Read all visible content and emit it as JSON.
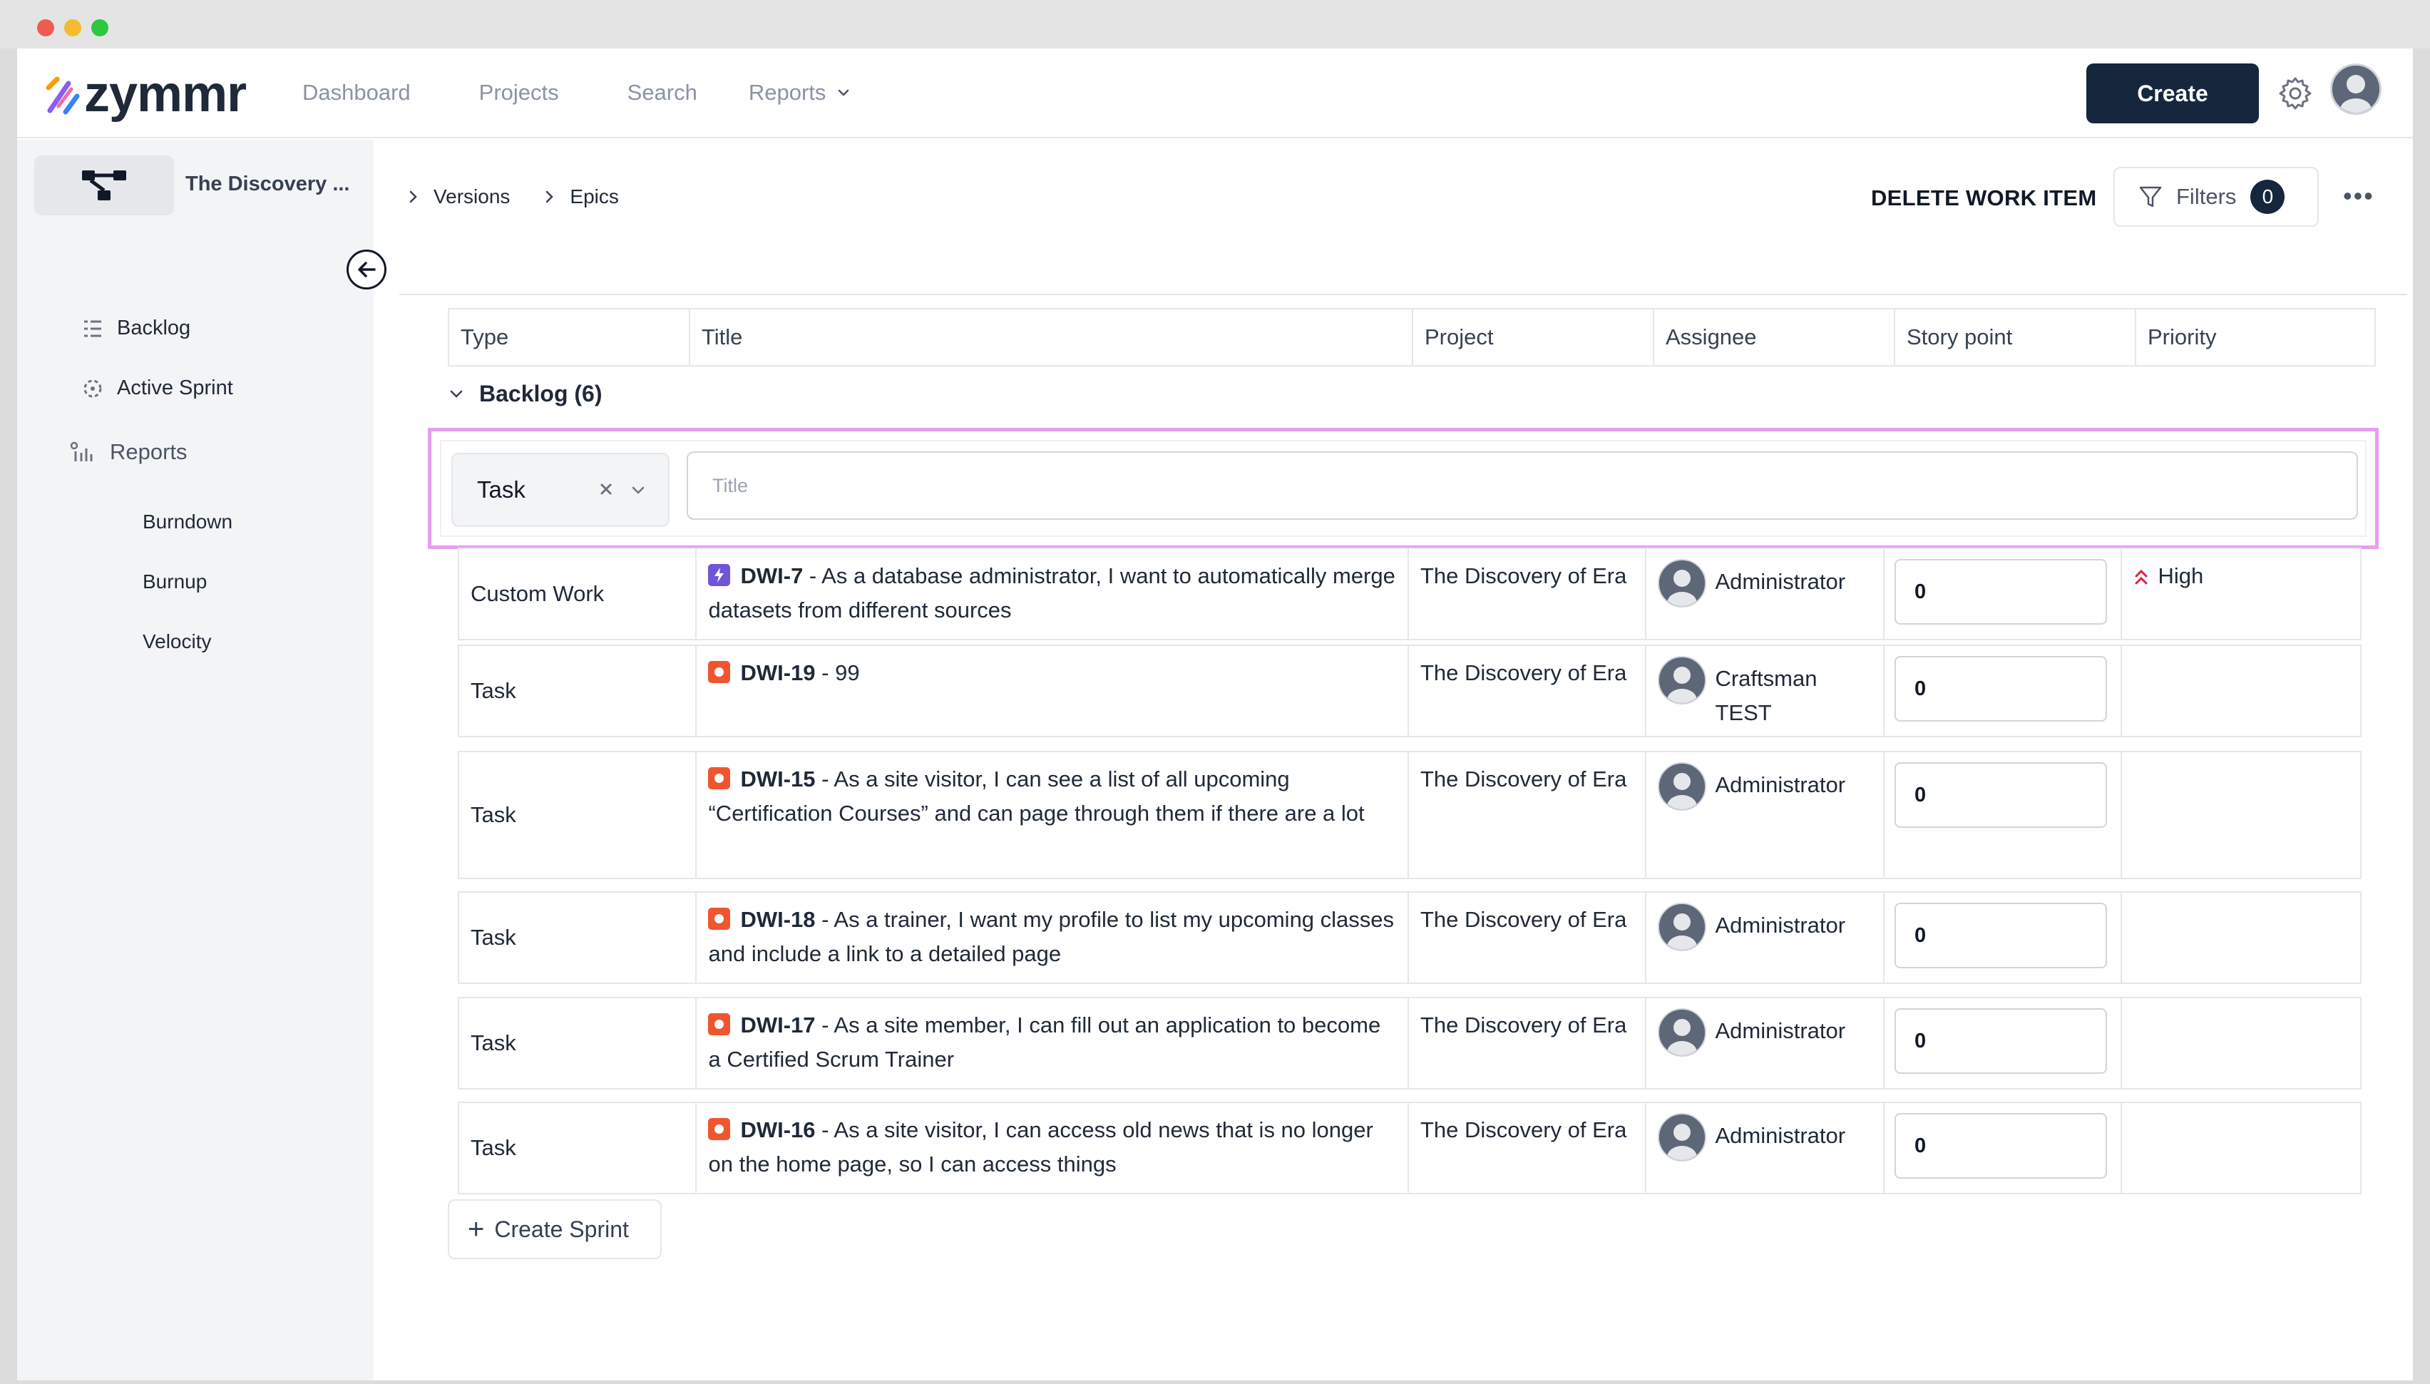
{
  "app": {
    "brand": "zymmr",
    "create_label": "Create"
  },
  "nav": {
    "items": [
      "Dashboard",
      "Projects",
      "Search",
      "Reports"
    ]
  },
  "sidebar": {
    "project_name": "The Discovery ...",
    "items": [
      {
        "label": "Backlog",
        "icon": "backlog-icon"
      },
      {
        "label": "Active Sprint",
        "icon": "sprint-icon"
      },
      {
        "label": "Reports",
        "icon": "reports-icon"
      }
    ],
    "report_items": [
      "Burndown",
      "Burnup",
      "Velocity"
    ]
  },
  "toolbar": {
    "breadcrumbs": [
      "Versions",
      "Epics"
    ],
    "delete_label": "DELETE WORK ITEM",
    "filters_label": "Filters",
    "filters_count": "0",
    "more_label": "•••"
  },
  "table": {
    "columns": [
      "Type",
      "Title",
      "Project",
      "Assignee",
      "Story point",
      "Priority"
    ],
    "group_label": "Backlog (6)",
    "quick_add": {
      "type_value": "Task",
      "title_placeholder": "Title"
    },
    "rows": [
      {
        "type": "Custom Work",
        "icon": "custom",
        "key": "DWI-7",
        "title": " - As a database administrator, I want to automatically merge datasets from different sources",
        "project": "The Discovery of Era",
        "assignee": "Administrator",
        "story_point": "0",
        "priority": "High"
      },
      {
        "type": "Task",
        "icon": "task",
        "key": "DWI-19",
        "title": " - 99",
        "project": "The Discovery of Era",
        "assignee": "Craftsman TEST",
        "story_point": "0",
        "priority": ""
      },
      {
        "type": "Task",
        "icon": "task",
        "key": "DWI-15",
        "title": " - As a site visitor, I can see a list of all upcoming “Certification Courses” and can page through them if there are a lot",
        "project": "The Discovery of Era",
        "assignee": "Administrator",
        "story_point": "0",
        "priority": ""
      },
      {
        "type": "Task",
        "icon": "task",
        "key": "DWI-18",
        "title": " - As a trainer, I want my profile to list my upcoming classes and include a link to a detailed page",
        "project": "The Discovery of Era",
        "assignee": "Administrator",
        "story_point": "0",
        "priority": ""
      },
      {
        "type": "Task",
        "icon": "task",
        "key": "DWI-17",
        "title": " - As a site member, I can fill out an application to become a Certified Scrum Trainer",
        "project": "The Discovery of Era",
        "assignee": "Administrator",
        "story_point": "0",
        "priority": ""
      },
      {
        "type": "Task",
        "icon": "task",
        "key": "DWI-16",
        "title": " - As a site visitor, I can access old news that is no longer on the home page, so I can access things",
        "project": "The Discovery of Era",
        "assignee": "Administrator",
        "story_point": "0",
        "priority": ""
      }
    ]
  },
  "create_sprint_label": "Create Sprint",
  "colors": {
    "primary": "#15263d",
    "task_icon": "#f0552f",
    "custom_icon": "#6f55d9",
    "priority_high": "#e11d48",
    "highlight_border": "#e59ef0"
  }
}
